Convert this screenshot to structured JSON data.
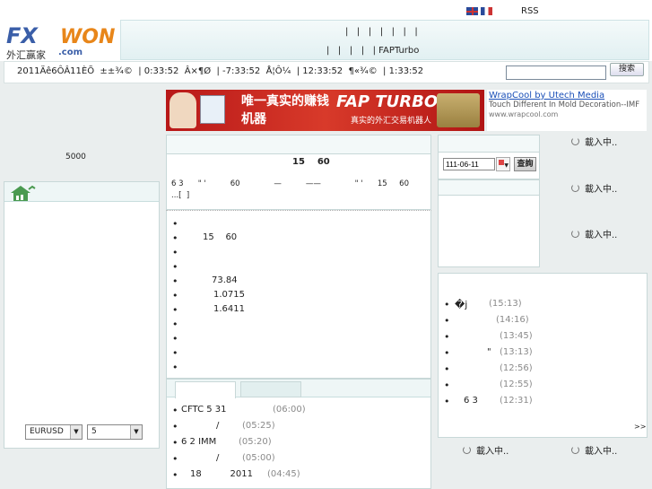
{
  "header": {
    "rss": "RSS",
    "nav_row1": "|   |   |   |   |   |   |",
    "nav_row2": "|   |   |   |   | FAPTurbo",
    "logo_sub": "外汇赢家",
    "logo_com": ".com",
    "logo_main_left": "FX",
    "logo_main_right": "WON"
  },
  "clockbar": {
    "text": "2011Äê6ÔÂ11ÈÕ  ±±¾©  | 0:33:52  Â×¶Ø  | -7:33:52  Å¦Ô¼  | 12:33:52  ¶«¾©  | 1:33:52",
    "search_value": "",
    "search_button": "搜索"
  },
  "banner": {
    "left_text": "唯一真实的赚钱机器",
    "brand": "FAP TURBO",
    "brand_sub": "真实的外汇交易机器人",
    "ad_title": "WrapCool by Utech Media",
    "ad_desc": "Touch Different In Mold Decoration--IMF",
    "ad_url": "www.wrapcool.com"
  },
  "left": {
    "number": "5000",
    "pair_select": "EURUSD",
    "period_select": "5"
  },
  "center": {
    "headline": "15    60",
    "summary": "6 3      \" '          60              —          ——              \" '      15     60",
    "summary2": "...[  ]",
    "bullets": [
      "",
      "15    60",
      "",
      "",
      "73.84",
      "1.0715",
      "1.6411",
      "",
      "",
      "",
      ""
    ],
    "news": [
      {
        "title": "CFTC 5 31",
        "time": "(06:00)"
      },
      {
        "title": "/",
        "time": "(05:25)"
      },
      {
        "title": "6 2 IMM",
        "time": "(05:20)"
      },
      {
        "title": "/",
        "time": "(05:00)"
      },
      {
        "title": "18          2011",
        "time": "(04:45)"
      }
    ]
  },
  "right": {
    "date_value": "111-06-11",
    "query_button": "查詢",
    "news": [
      {
        "title": "�j",
        "time": "(15:13)"
      },
      {
        "title": "",
        "time": "(14:16)"
      },
      {
        "title": "",
        "time": "(13:45)"
      },
      {
        "title": "\"",
        "time": "(13:13)"
      },
      {
        "title": "",
        "time": "(12:56)"
      },
      {
        "title": "",
        "time": "(12:55)"
      },
      {
        "title": "6 3",
        "time": "(12:31)"
      }
    ],
    "more": ">>",
    "loading": "載入中.."
  }
}
